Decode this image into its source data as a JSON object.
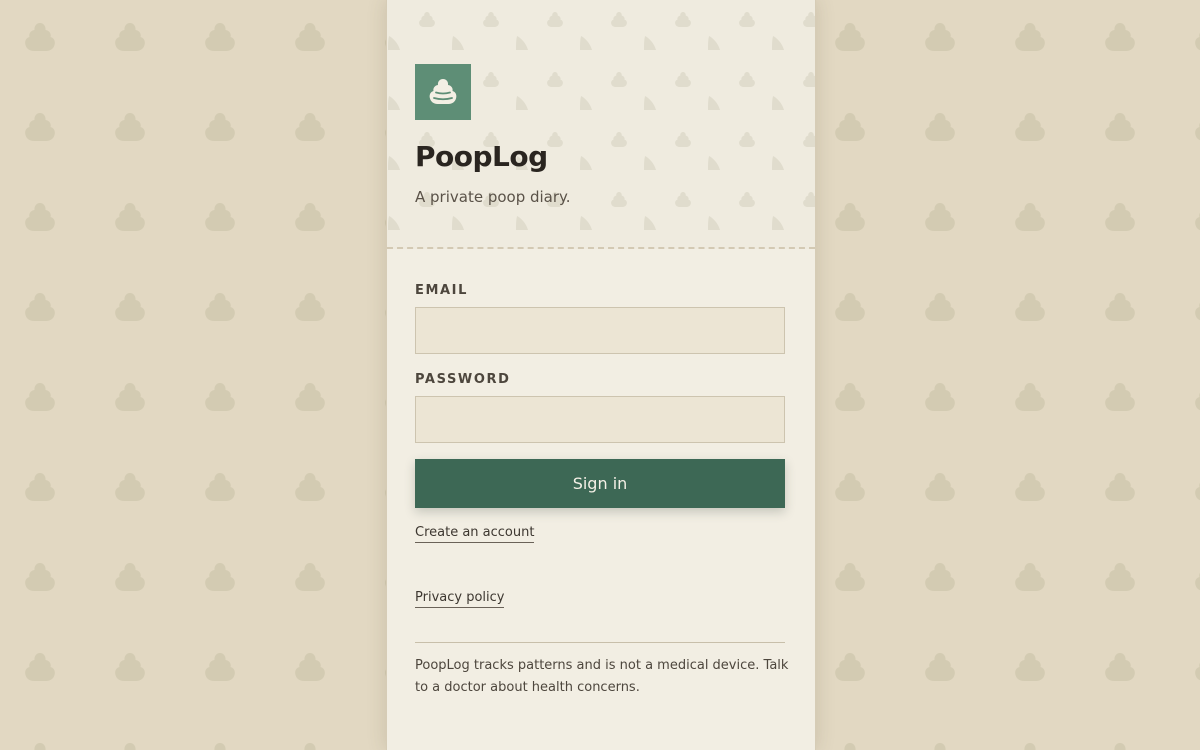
{
  "app": {
    "title": "PoopLog",
    "tagline": "A private poop diary.",
    "logo_icon": "poop-icon"
  },
  "form": {
    "email_label": "EMAIL",
    "email_value": "",
    "email_placeholder": "",
    "password_label": "PASSWORD",
    "password_value": "",
    "password_placeholder": "",
    "sign_in_label": "Sign in"
  },
  "links": {
    "create_account": "Create an account",
    "privacy_policy": "Privacy policy"
  },
  "footer": {
    "disclaimer": "PoopLog tracks patterns and is not a medical device. Talk to a doctor about health concerns."
  },
  "colors": {
    "background": "#e2d8c2",
    "card": "#f2eee3",
    "accent": "#3d6855",
    "logo_bg": "#5e8e76",
    "input_bg": "#ece5d4"
  }
}
